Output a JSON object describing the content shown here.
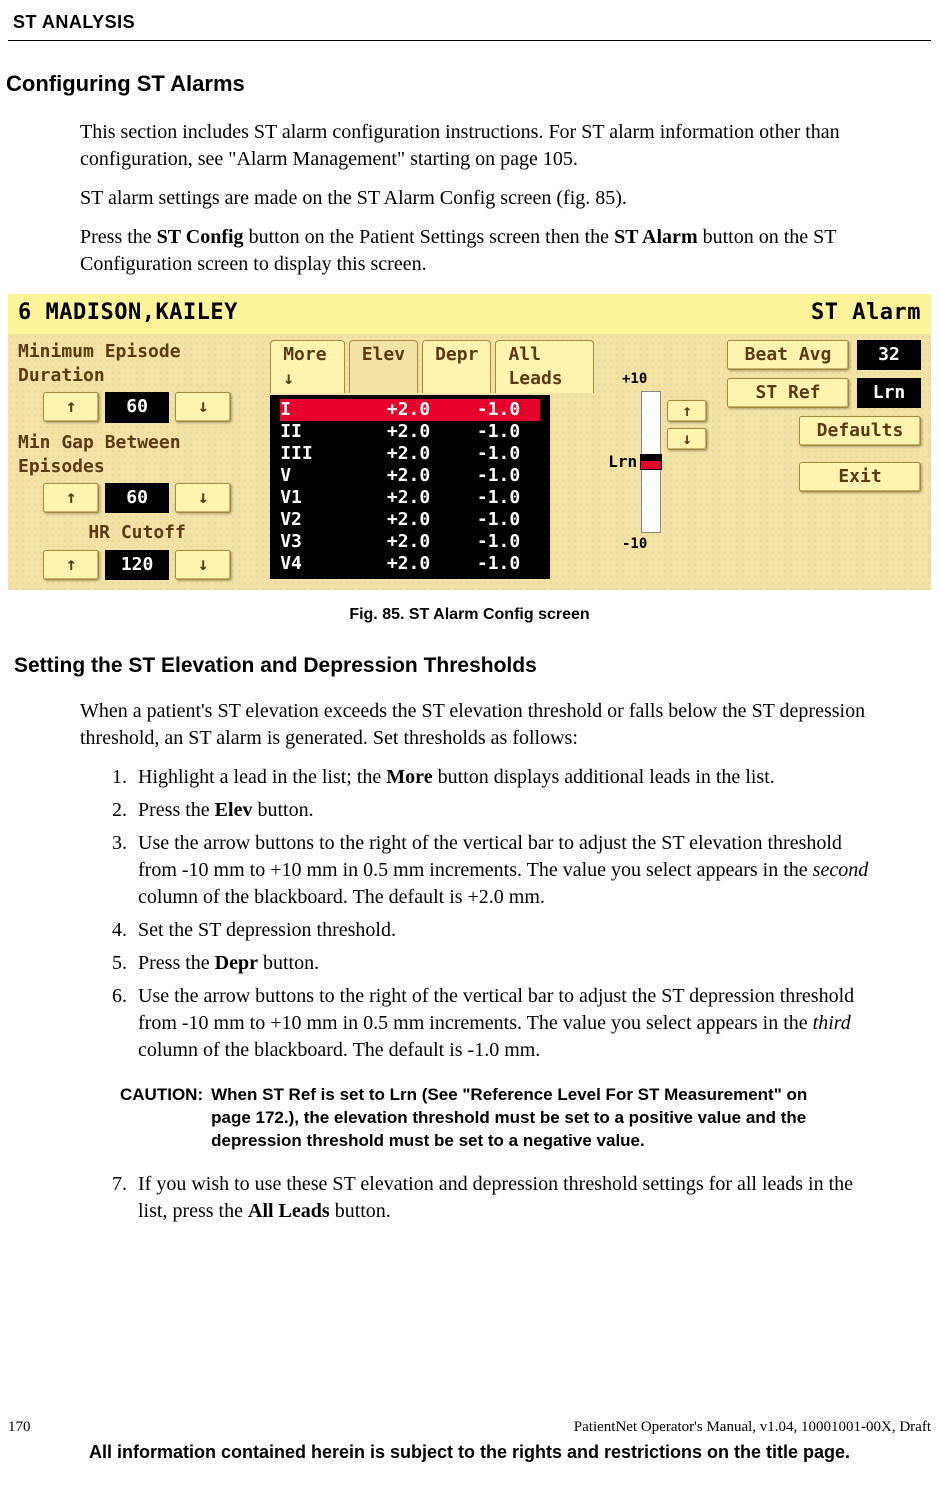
{
  "header": "ST ANALYSIS",
  "h2": "Configuring ST Alarms",
  "para1a": "This section includes ST alarm configuration instructions. For ST alarm information other than configuration, see \"Alarm Management\" starting on page 105.",
  "para1b": "ST alarm settings are made on the ST Alarm Config screen (fig. 85).",
  "para1c_a": "Press the ",
  "para1c_b": "ST Config",
  "para1c_c": " button on the Patient Settings screen then the ",
  "para1c_d": "ST Alarm",
  "para1c_e": " button on the ST Configuration screen to display this screen.",
  "figcap": "Fig. 85. ST Alarm Config screen",
  "h3": "Setting the ST Elevation and Depression Thresholds",
  "para2": "When a patient's ST elevation exceeds the ST elevation threshold or falls below the ST depression threshold, an ST alarm is generated. Set thresholds as follows:",
  "steps": {
    "s1a": "Highlight a lead in the list; the ",
    "s1b": "More",
    "s1c": " button displays additional leads in the list.",
    "s2a": "Press the ",
    "s2b": "Elev",
    "s2c": " button.",
    "s3a": "Use the arrow buttons to the right of the vertical bar to adjust the ST elevation threshold from -10 mm to +10 mm in 0.5 mm increments. The value you select appears in the ",
    "s3b": "second",
    "s3c": " column of the blackboard. The default is +2.0 mm.",
    "s4": "Set the ST depression threshold.",
    "s5a": "Press the ",
    "s5b": "Depr",
    "s5c": " button.",
    "s6a": "Use the arrow buttons to the right of the vertical bar to adjust the ST depression threshold from -10 mm to +10 mm in 0.5 mm increments. The value you select appears in the ",
    "s6b": "third",
    "s6c": " column of the blackboard. The default is -1.0 mm.",
    "s7a": "If you wish to use these ST elevation and depression threshold settings for all leads in the list, press the ",
    "s7b": "All Leads",
    "s7c": " button."
  },
  "caution_label": "CAUTION:",
  "caution_text": "When ST Ref is set to Lrn (See \"Reference Level For ST Measurement\" on page 172.), the elevation threshold must be set to a positive value and the depression threshold must be set to a negative value.",
  "footer": {
    "pagenum": "170",
    "docinfo": "PatientNet Operator's Manual, v1.04, 10001001-00X, Draft",
    "restrict": "All information contained herein is subject to the rights and restrictions on the title page."
  },
  "ui": {
    "title_left": "6  MADISON,KAILEY",
    "title_right": "ST Alarm",
    "min_ep": "Minimum Episode Duration",
    "min_ep_val": "60",
    "min_gap": "Min Gap Between Episodes",
    "min_gap_val": "60",
    "hr_cutoff": "HR Cutoff",
    "hr_cutoff_val": "120",
    "more": "More ↓",
    "elev": "Elev",
    "depr": "Depr",
    "all_leads": "All Leads",
    "bar_top": "+10",
    "bar_mid": "Lrn",
    "bar_bot": "-10",
    "beat_avg": "Beat Avg",
    "beat_avg_val": "32",
    "st_ref": "ST Ref",
    "st_ref_val": "Lrn",
    "defaults": "Defaults",
    "exit": "Exit",
    "arrow_up": "↑",
    "arrow_dn": "↓",
    "leads": [
      {
        "n": "I",
        "e": "+2.0",
        "d": "-1.0"
      },
      {
        "n": "II",
        "e": "+2.0",
        "d": "-1.0"
      },
      {
        "n": "III",
        "e": "+2.0",
        "d": "-1.0"
      },
      {
        "n": "V",
        "e": "+2.0",
        "d": "-1.0"
      },
      {
        "n": "V1",
        "e": "+2.0",
        "d": "-1.0"
      },
      {
        "n": "V2",
        "e": "+2.0",
        "d": "-1.0"
      },
      {
        "n": "V3",
        "e": "+2.0",
        "d": "-1.0"
      },
      {
        "n": "V4",
        "e": "+2.0",
        "d": "-1.0"
      }
    ]
  }
}
